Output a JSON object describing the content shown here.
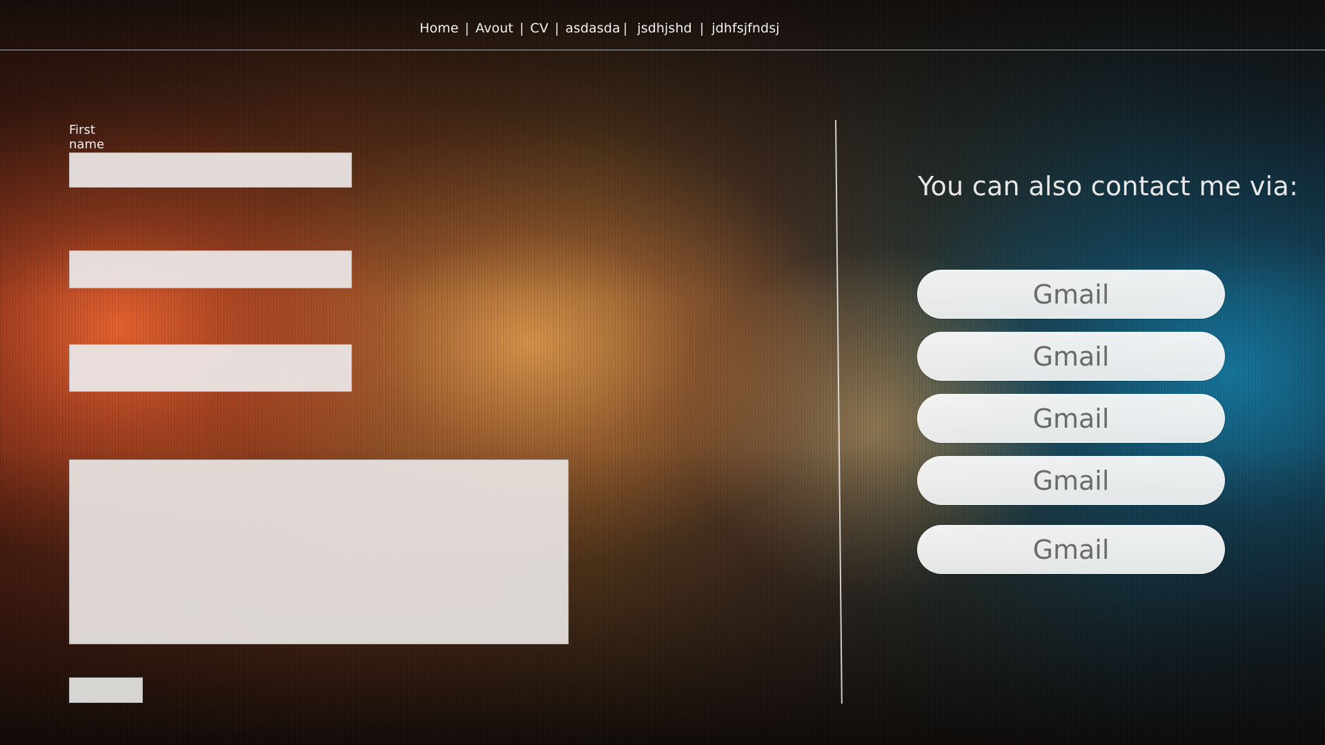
{
  "nav": {
    "items": [
      {
        "label": "Home"
      },
      {
        "label": "Avout"
      },
      {
        "label": "CV"
      },
      {
        "label": "asdasda"
      },
      {
        "label": "jsdhjshd"
      },
      {
        "label": "jdhfsjfndsj"
      }
    ],
    "separator": "|"
  },
  "form": {
    "first_name_label": "First name",
    "fields": [
      {
        "value": "",
        "placeholder": ""
      },
      {
        "value": "",
        "placeholder": ""
      },
      {
        "value": "",
        "placeholder": ""
      }
    ],
    "message": {
      "value": "",
      "placeholder": ""
    },
    "submit_label": ""
  },
  "contact": {
    "heading": "You can also contact me via:",
    "buttons": [
      {
        "label": "Gmail"
      },
      {
        "label": "Gmail"
      },
      {
        "label": "Gmail"
      },
      {
        "label": "Gmail"
      },
      {
        "label": "Gmail"
      }
    ]
  },
  "colors": {
    "left_glow": "#e25c2e",
    "center_glow": "#d89a54",
    "right_glow": "#1a7aa0",
    "field_background": "#ece8e8",
    "contact_button_text": "#6a6a6a"
  }
}
